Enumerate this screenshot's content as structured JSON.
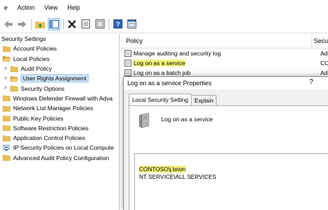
{
  "menu": {
    "items": [
      "e",
      "Action",
      "View",
      "Help"
    ]
  },
  "toolbar": {
    "buttons": [
      "back-icon",
      "forward-icon",
      "up-folder-icon",
      "show-tree-icon",
      "delete-icon",
      "properties-icon",
      "export-icon",
      "help-icon",
      "console-icon"
    ]
  },
  "tree": {
    "items": [
      {
        "label": "Security Settings",
        "level": 0,
        "caret": ""
      },
      {
        "label": "Account Policies",
        "level": 1,
        "caret": ""
      },
      {
        "label": "Local Policies",
        "level": 1,
        "caret": ""
      },
      {
        "label": "Audit Policy",
        "level": 2,
        "caret": ">"
      },
      {
        "label": "User Rights Assignment",
        "level": 2,
        "caret": ">",
        "selected": true
      },
      {
        "label": "Security Options",
        "level": 2,
        "caret": ">"
      },
      {
        "label": "Windows Defender Firewall with Adva",
        "level": 1,
        "caret": ""
      },
      {
        "label": "Network List Manager Policies",
        "level": 1,
        "caret": ""
      },
      {
        "label": "Public Key Policies",
        "level": 1,
        "caret": ""
      },
      {
        "label": "Software Restriction Policies",
        "level": 1,
        "caret": ""
      },
      {
        "label": "Application Control Policies",
        "level": 1,
        "caret": ""
      },
      {
        "label": "IP Security Policies on Local Compute",
        "level": 1,
        "caret": ""
      },
      {
        "label": "Advanced Audit Policy Configuration",
        "level": 1,
        "caret": ""
      }
    ]
  },
  "list": {
    "col_policy": "Policy",
    "col_security": "Secu",
    "rows": [
      {
        "policy": "Manage auditing and security log",
        "security": "Adm"
      },
      {
        "policy": "Log on as a service",
        "security": "CONT",
        "highlight": true
      },
      {
        "policy": "Log on as a batch job",
        "security": "Adm"
      }
    ]
  },
  "dialog": {
    "title": "Log on as a service Properties",
    "help": "?",
    "tabs": [
      "Local Security Setting",
      "Explain"
    ],
    "policy_name": "Log on as a service",
    "accounts": [
      "CONTOSO\\j.brion",
      "NT SERVICE\\ALL SERVICES"
    ]
  },
  "colors": {
    "highlight": "#f6f27a",
    "selection": "#cfe3f6",
    "folder": "#e8c15a"
  }
}
